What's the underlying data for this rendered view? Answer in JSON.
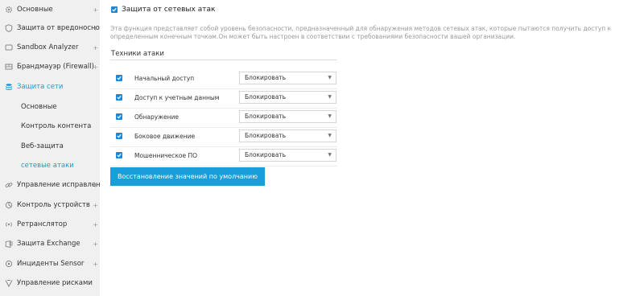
{
  "sidebar": {
    "items": [
      {
        "label": "Основные",
        "icon": "gear-icon",
        "expandable": true
      },
      {
        "label": "Защита от вредоносного",
        "icon": "shield-icon",
        "expandable": true
      },
      {
        "label": "Sandbox Analyzer",
        "icon": "",
        "expandable": true
      },
      {
        "label": "Брандмауэр (Firewall)",
        "icon": "",
        "expandable": true
      },
      {
        "label": "Защита сети",
        "icon": "stack-icon",
        "expandable": false,
        "active": true
      },
      {
        "label": "Управление исправлениями",
        "icon": "link-icon",
        "expandable": true
      },
      {
        "label": "Контроль устройств",
        "icon": "device-icon",
        "expandable": true
      },
      {
        "label": "Ретранслятор",
        "icon": "relay-icon",
        "expandable": true
      },
      {
        "label": "Защита Exchange",
        "icon": "exchange-icon",
        "expandable": true
      },
      {
        "label": "Инциденты Sensor",
        "icon": "sensor-icon",
        "expandable": true
      },
      {
        "label": "Управление рисками",
        "icon": "risk-icon",
        "expandable": false
      }
    ],
    "subitems": [
      {
        "label": "Основные"
      },
      {
        "label": "Контроль контента"
      },
      {
        "label": "Веб-защита"
      },
      {
        "label": "сетевые атаки",
        "active": true
      }
    ],
    "plus_symbol": "+"
  },
  "main": {
    "header_title": "Защита от сетевых атак",
    "header_checked": true,
    "description": "Эта функция представляет собой уровень безопасности, предназначенный для обнаружения методов сетевых атак, которые пытаются получить доступ к определенным конечным точкам.Он может быть настроен в соответствии с требованиями безопасности вашей организации.",
    "section_title": "Техники атаки",
    "techniques": [
      {
        "name": "Начальный доступ",
        "checked": true,
        "action": "Блокировать"
      },
      {
        "name": "Доступ к учетным данным",
        "checked": true,
        "action": "Блокировать"
      },
      {
        "name": "Обнаружение",
        "checked": true,
        "action": "Блокировать"
      },
      {
        "name": "Боковое движение",
        "checked": true,
        "action": "Блокировать"
      },
      {
        "name": "Мошенническое ПО",
        "checked": true,
        "action": "Блокировать"
      }
    ],
    "restore_button": "Восстановление значений по умолчанию"
  },
  "colors": {
    "accent": "#1a9bd7",
    "checkbox": "#1f87d4",
    "button": "#199ed9",
    "sidebar_bg": "#f0f0f0"
  }
}
